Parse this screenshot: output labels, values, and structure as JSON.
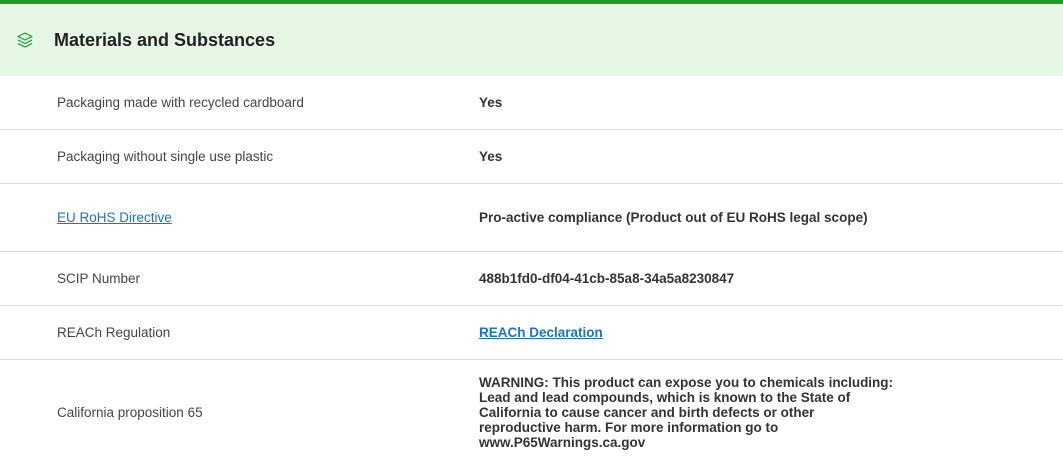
{
  "section": {
    "title": "Materials and Substances",
    "icon": "layers-icon",
    "accent_color": "#1a9e2b",
    "header_bg": "#e6f7e6"
  },
  "rows": [
    {
      "label": "Packaging made with recycled cardboard",
      "value": "Yes"
    },
    {
      "label": "Packaging without single use plastic",
      "value": "Yes"
    },
    {
      "label": "EU RoHS Directive",
      "value": "Pro-active compliance (Product out of EU RoHS legal scope)"
    },
    {
      "label": "SCIP Number",
      "value": "488b1fd0-df04-41cb-85a8-34a5a8230847"
    },
    {
      "label": "REACh Regulation",
      "value": "REACh Declaration"
    },
    {
      "label": "California proposition 65",
      "value": "WARNING: This product can expose you to chemicals including: Lead and lead compounds, which is known to the State of California to cause cancer and birth defects or other reproductive harm. For more information go to www.P65Warnings.ca.gov"
    }
  ],
  "link_color": "#1a73c8"
}
